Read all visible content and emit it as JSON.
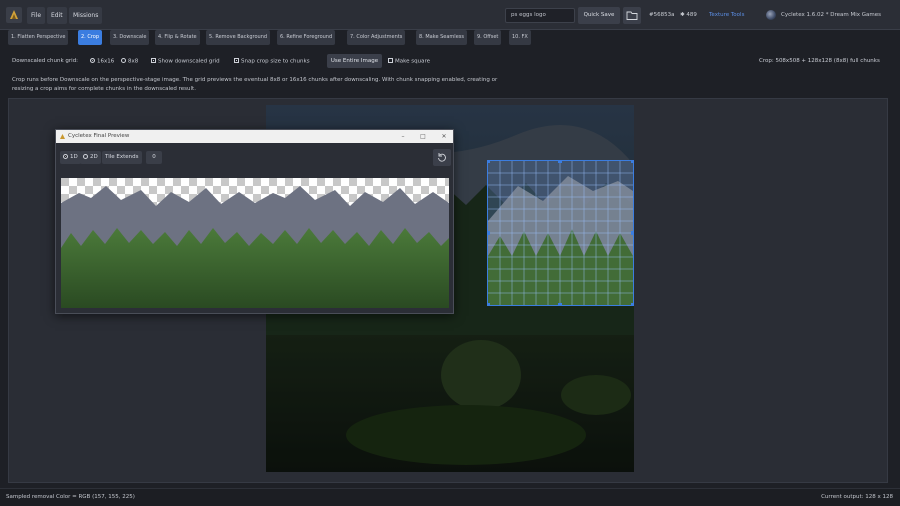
{
  "menu": {
    "file": "File",
    "edit": "Edit",
    "missions": "Missions"
  },
  "topbar": {
    "search_value": "ps eggs logo",
    "quick_save": "Quick Save",
    "color_hex": "#56853a",
    "count": "489",
    "texture_tools": "Texture Tools",
    "version": "Cycletex 1.6.02 * Dream Mix Games"
  },
  "tabs": [
    "1. Flatten Perspective",
    "2. Crop",
    "3. Downscale",
    "4. Flip & Rotate",
    "5. Remove Background",
    "6. Refine Foreground",
    "7. Color Adjustments",
    "8. Make Seamless",
    "9. Offset",
    "10. FX"
  ],
  "options": {
    "grid_label": "Downscaled chunk grid:",
    "opt_16": "16x16",
    "opt_8": "8x8",
    "show_grid": "Show downscaled grid",
    "snap": "Snap crop size to chunks",
    "use_entire": "Use Entire Image",
    "make_square": "Make square",
    "crop_info": "Crop: 508x508 + 128x128 (8x8) full chunks"
  },
  "description": "Crop runs before Downscale on the perspective-stage image. The grid previews the eventual 8x8 or 16x16 chunks after downscaling. With chunk snapping enabled, creating or resizing a crop aims for complete chunks in the downscaled result.",
  "preview": {
    "title": "Cycletex Final Preview",
    "opt_1d": "1D",
    "opt_2d": "2D",
    "tile_extends": "Tile Extends",
    "tile_count": "0"
  },
  "status": {
    "left": "Sampled removal Color = RGB (157, 155, 225)",
    "right": "Current output: 128 x 128"
  },
  "colors": {
    "accent": "#3b7de0",
    "background": "#1e2026",
    "texture_tools": "#5c8fe6"
  }
}
